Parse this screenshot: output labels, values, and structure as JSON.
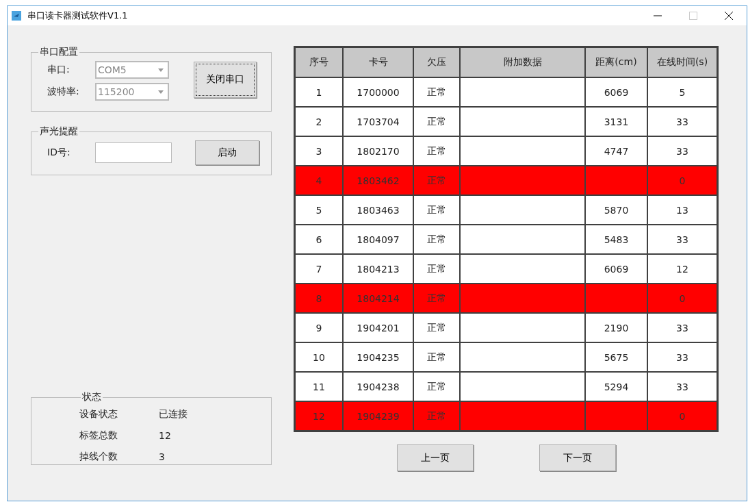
{
  "window": {
    "title": "串口读卡器测试软件V1.1"
  },
  "serial_config": {
    "title": "串口配置",
    "fields": [
      {
        "label": "串口:",
        "value": "COM5",
        "disabled": true
      },
      {
        "label": "波特率:",
        "value": "115200",
        "disabled": true
      }
    ],
    "button": "关闭串口"
  },
  "alert": {
    "title": "声光提醒",
    "label": "ID号:",
    "button": "启动"
  },
  "status": {
    "title": "状态",
    "items": [
      {
        "label": "设备状态",
        "value": "已连接"
      },
      {
        "label": "标签总数",
        "value": "12"
      },
      {
        "label": "掉线个数",
        "value": "3"
      }
    ]
  },
  "table": {
    "columns": [
      "序号",
      "卡号",
      "欠压",
      "附加数据",
      "距离(cm)",
      "在线时间(s)"
    ],
    "rows": [
      {
        "cells": [
          "1",
          "1700000",
          "正常",
          "",
          "6069",
          "5"
        ],
        "alarm": false
      },
      {
        "cells": [
          "2",
          "1703704",
          "正常",
          "",
          "3131",
          "33"
        ],
        "alarm": false
      },
      {
        "cells": [
          "3",
          "1802170",
          "正常",
          "",
          "4747",
          "33"
        ],
        "alarm": false
      },
      {
        "cells": [
          "4",
          "1803462",
          "正常",
          "",
          "",
          "0"
        ],
        "alarm": true
      },
      {
        "cells": [
          "5",
          "1803463",
          "正常",
          "",
          "5870",
          "13"
        ],
        "alarm": false
      },
      {
        "cells": [
          "6",
          "1804097",
          "正常",
          "",
          "5483",
          "33"
        ],
        "alarm": false
      },
      {
        "cells": [
          "7",
          "1804213",
          "正常",
          "",
          "6069",
          "12"
        ],
        "alarm": false
      },
      {
        "cells": [
          "8",
          "1804214",
          "正常",
          "",
          "",
          "0"
        ],
        "alarm": true
      },
      {
        "cells": [
          "9",
          "1904201",
          "正常",
          "",
          "2190",
          "33"
        ],
        "alarm": false
      },
      {
        "cells": [
          "10",
          "1904235",
          "正常",
          "",
          "5675",
          "33"
        ],
        "alarm": false
      },
      {
        "cells": [
          "11",
          "1904238",
          "正常",
          "",
          "5294",
          "33"
        ],
        "alarm": false
      },
      {
        "cells": [
          "12",
          "1904239",
          "正常",
          "",
          "",
          "0"
        ],
        "alarm": true
      }
    ]
  },
  "pager": [
    "上一页",
    "下一页"
  ]
}
